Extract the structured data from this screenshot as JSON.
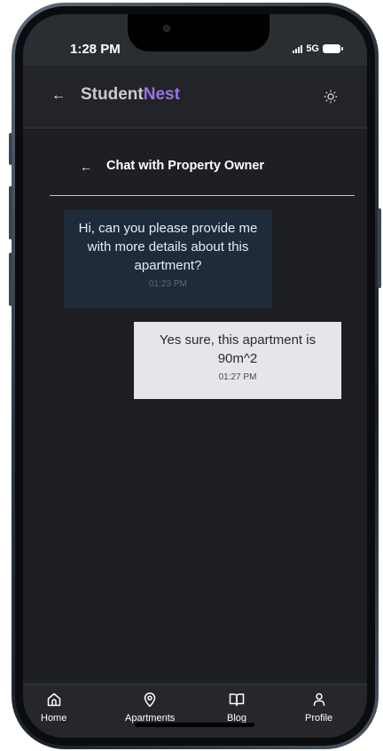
{
  "status_bar": {
    "time": "1:28 PM",
    "network": "5G"
  },
  "header": {
    "back_icon": "arrow-left-icon",
    "brand_prefix": "Student",
    "brand_suffix": "Nest",
    "theme_icon": "sun-icon",
    "accent_color": "#9b72e8"
  },
  "chat": {
    "back_icon": "arrow-left-icon",
    "title": "Chat with Property Owner",
    "messages": [
      {
        "direction": "incoming",
        "text": "Hi, can you please provide me with more details about this apartment?",
        "time": "01:23 PM",
        "bubble_color": "#1f2a3a"
      },
      {
        "direction": "outgoing",
        "text": "Yes sure, this apartment is 90m^2",
        "time": "01:27 PM",
        "bubble_color": "#e5e6e9"
      }
    ]
  },
  "bottom_nav": {
    "items": [
      {
        "label": "Home",
        "icon": "home-icon"
      },
      {
        "label": "Apartments",
        "icon": "map-pin-icon"
      },
      {
        "label": "Blog",
        "icon": "book-icon"
      },
      {
        "label": "Profile",
        "icon": "user-icon"
      }
    ]
  }
}
